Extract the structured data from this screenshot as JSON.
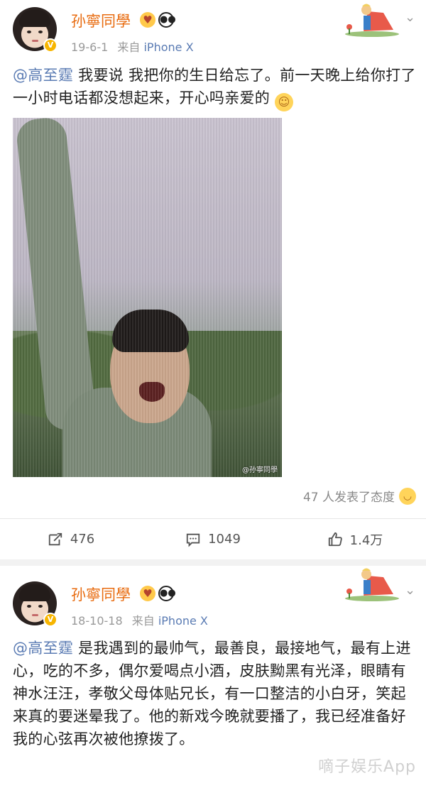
{
  "posts": [
    {
      "username": "孙寧同學",
      "date": "19-6-1",
      "source_prefix": "来自",
      "source_device": "iPhone X",
      "mention": "@高至霆",
      "text": " 我要说  我把你的生日给忘了。前一天晚上给你打了一小时电话都没想起来，开心吗亲爱的",
      "photo_watermark": "@孙寧同學",
      "reactions_text": "47 人发表了态度",
      "actions": {
        "repost_count": "476",
        "comment_count": "1049",
        "like_count": "1.4万"
      },
      "icons": [
        "fan-badge-icon",
        "panda-icon",
        "verified-icon",
        "smile-emoji-icon",
        "laugh-emoji-icon",
        "repost-icon",
        "comment-icon",
        "like-icon",
        "chevron-down-icon"
      ]
    },
    {
      "username": "孙寧同學",
      "date": "18-10-18",
      "source_prefix": "来自",
      "source_device": "iPhone X",
      "mention": "@高至霆",
      "text": " 是我遇到的最帅气，最善良，最接地气，最有上进心，吃的不多，偶尔爱喝点小酒，皮肤黝黑有光泽，眼睛有神水汪汪，孝敬父母体贴兄长，有一口整洁的小白牙，笑起来真的要迷晕我了。他的新戏今晚就要播了，我已经准备好我的心弦再次被他撩拨了。"
    }
  ],
  "watermark": "嘀子娱乐App",
  "colors": {
    "username": "#e86b0f",
    "link": "#5a7bb3",
    "verified": "#f7b500",
    "meta": "#999999"
  }
}
